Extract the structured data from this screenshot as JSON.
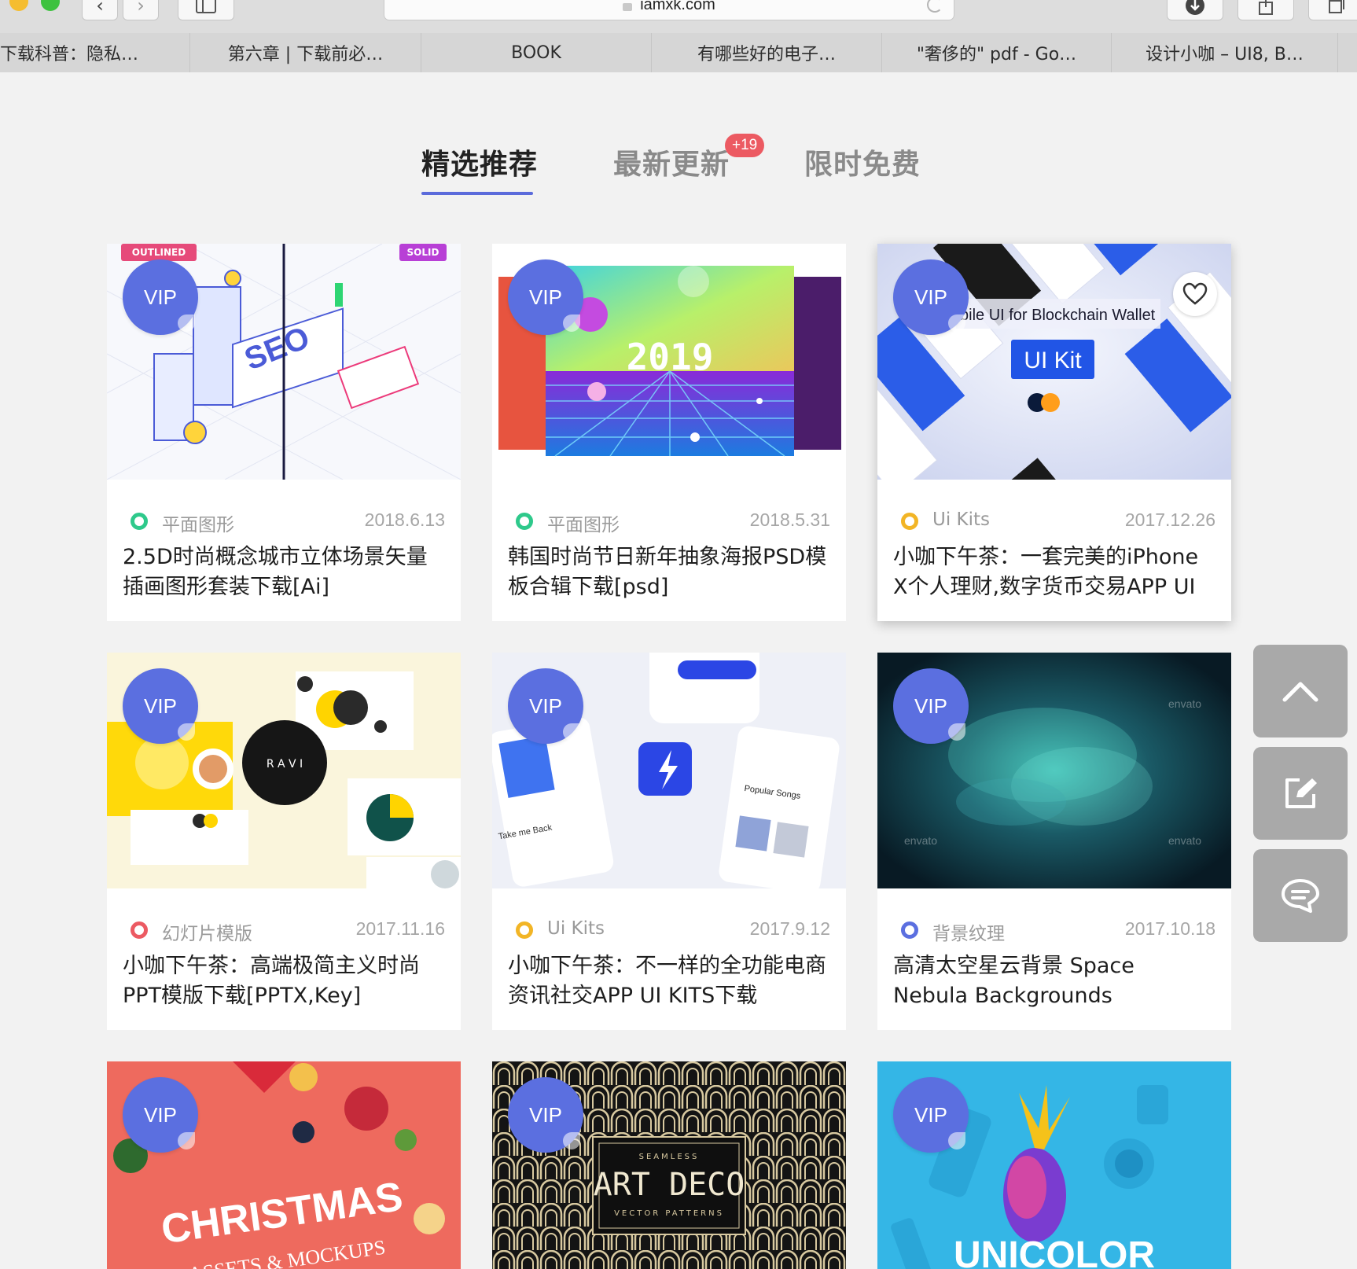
{
  "browser": {
    "address": "iamxk.com",
    "tabs": [
      "下载科普：隐私…",
      "第六章 | 下载前必…",
      "BOOK",
      "有哪些好的电子…",
      "\"奢侈的\" pdf - Go…",
      "设计小咖 – UI8, B…"
    ]
  },
  "section_tabs": {
    "featured": "精选推荐",
    "latest": "最新更新",
    "latest_badge": "+19",
    "free": "限时免费"
  },
  "vip_label": "VIP",
  "cards": [
    {
      "category": "平面图形",
      "dot_color": "#2ec98b",
      "date": "2018.6.13",
      "title": "2.5D时尚概念城市立体场景矢量插画图形套装下载[Ai]",
      "thumb_tag_left": "OUTLINED",
      "thumb_tag_right": "SOLID",
      "thumb_text": "SEO"
    },
    {
      "category": "平面图形",
      "dot_color": "#2ec98b",
      "date": "2018.5.31",
      "title": "韩国时尚节日新年抽象海报PSD模板合辑下载[psd]",
      "thumb_text": "2019"
    },
    {
      "category": "Ui Kits",
      "dot_color": "#f2b526",
      "date": "2017.12.26",
      "title": "小咖下午茶：一套完美的iPhone X个人理财,数字货币交易APP UI",
      "thumb_text": "bile UI for Blockchain Wallet",
      "thumb_text2": "UI Kit"
    },
    {
      "category": "幻灯片模版",
      "dot_color": "#ec5a62",
      "date": "2017.11.16",
      "title": "小咖下午茶：高端极简主义时尚PPT模版下载[PPTX,Key]",
      "thumb_text": "R A V I"
    },
    {
      "category": "Ui Kits",
      "dot_color": "#f2b526",
      "date": "2017.9.12",
      "title": "小咖下午茶：不一样的全功能电商资讯社交APP UI KITS下载",
      "thumb_text": "Popular Songs",
      "thumb_text2": "Take me Back"
    },
    {
      "category": "背景纹理",
      "dot_color": "#5b6fe0",
      "date": "2017.10.18",
      "title": "高清太空星云背景 Space Nebula Backgrounds",
      "thumb_text": "envato"
    },
    {
      "thumb_text": "CHRISTMAS",
      "thumb_text2": "ASSETS & MOCKUPS"
    },
    {
      "thumb_text": "ART DECO",
      "thumb_text2": "SEAMLESS",
      "thumb_text3": "VECTOR PATTERNS"
    },
    {
      "thumb_text": "UNICOLOR"
    }
  ],
  "colors": {
    "accent": "#5b6bdb",
    "vip": "#5b6fe0",
    "badge": "#ec5a62",
    "side_button": "#a9a9a9"
  },
  "icons": {
    "side": [
      "arrow-up-icon",
      "edit-icon",
      "comment-icon"
    ],
    "card": "heart-icon"
  }
}
